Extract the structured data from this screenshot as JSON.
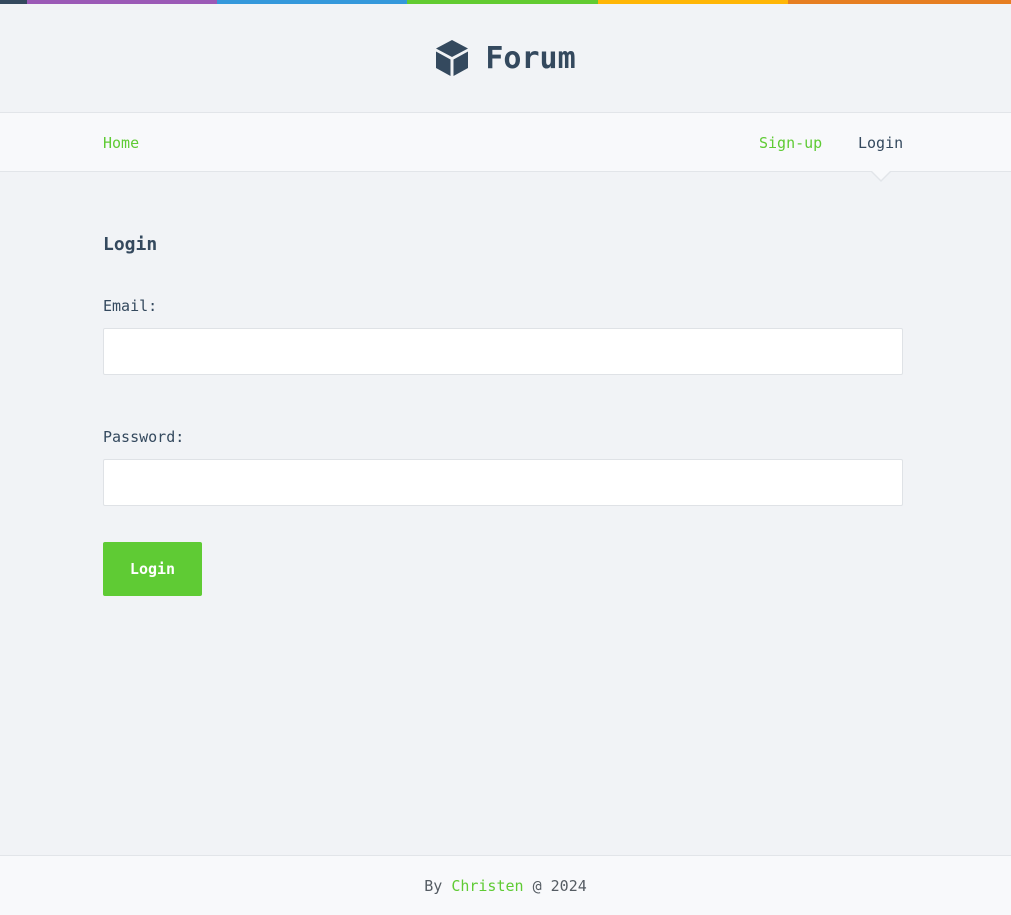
{
  "colors": {
    "accent": "#5fcb34",
    "text": "#34495e",
    "background": "#f1f3f6",
    "stripe": [
      "#34495e",
      "#9b59b6",
      "#3498db",
      "#62cb31",
      "#ffb606",
      "#e67e22"
    ]
  },
  "header": {
    "logo_icon": "cube-icon",
    "title": "Forum"
  },
  "nav": {
    "home": "Home",
    "signup": "Sign-up",
    "login": "Login"
  },
  "form": {
    "title": "Login",
    "email_label": "Email:",
    "email_value": "",
    "password_label": "Password:",
    "password_value": "",
    "submit_label": "Login"
  },
  "footer": {
    "by": "By ",
    "author": "Christen",
    "suffix": " @ 2024"
  }
}
